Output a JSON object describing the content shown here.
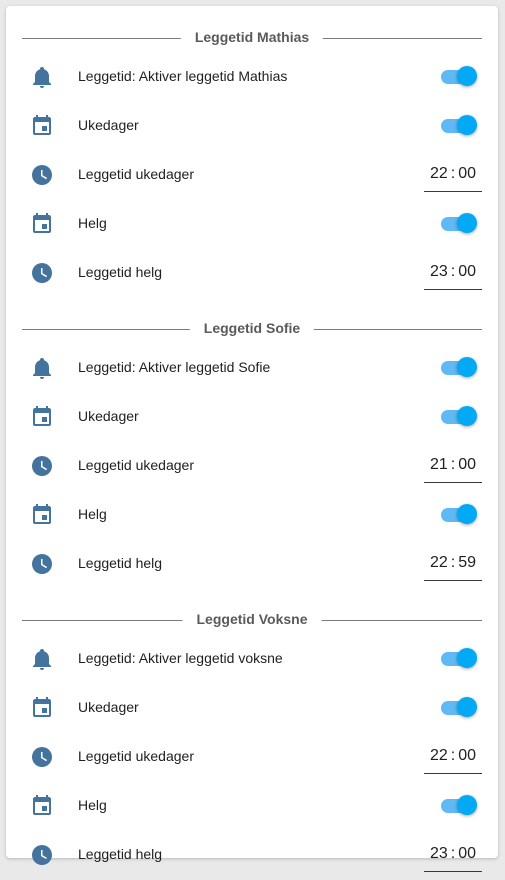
{
  "colors": {
    "icon": "#44739e",
    "toggle_thumb": "#03a9f4",
    "toggle_track": "#5fb9f4",
    "header_text": "#5a5a5a"
  },
  "sections": [
    {
      "title": "Leggetid Mathias",
      "rows": [
        {
          "icon": "bell-icon",
          "label": "Leggetid: Aktiver leggetid Mathias",
          "control": "toggle",
          "on": true
        },
        {
          "icon": "calendar-icon",
          "label": "Ukedager",
          "control": "toggle",
          "on": true
        },
        {
          "icon": "clock-icon",
          "label": "Leggetid ukedager",
          "control": "time",
          "hour": "22",
          "minute": "00"
        },
        {
          "icon": "calendar-icon",
          "label": "Helg",
          "control": "toggle",
          "on": true
        },
        {
          "icon": "clock-icon",
          "label": "Leggetid helg",
          "control": "time",
          "hour": "23",
          "minute": "00"
        }
      ]
    },
    {
      "title": "Leggetid Sofie",
      "rows": [
        {
          "icon": "bell-icon",
          "label": "Leggetid: Aktiver leggetid Sofie",
          "control": "toggle",
          "on": true
        },
        {
          "icon": "calendar-icon",
          "label": "Ukedager",
          "control": "toggle",
          "on": true
        },
        {
          "icon": "clock-icon",
          "label": "Leggetid ukedager",
          "control": "time",
          "hour": "21",
          "minute": "00"
        },
        {
          "icon": "calendar-icon",
          "label": "Helg",
          "control": "toggle",
          "on": true
        },
        {
          "icon": "clock-icon",
          "label": "Leggetid helg",
          "control": "time",
          "hour": "22",
          "minute": "59"
        }
      ]
    },
    {
      "title": "Leggetid Voksne",
      "rows": [
        {
          "icon": "bell-icon",
          "label": "Leggetid: Aktiver leggetid voksne",
          "control": "toggle",
          "on": true
        },
        {
          "icon": "calendar-icon",
          "label": "Ukedager",
          "control": "toggle",
          "on": true
        },
        {
          "icon": "clock-icon",
          "label": "Leggetid ukedager",
          "control": "time",
          "hour": "22",
          "minute": "00"
        },
        {
          "icon": "calendar-icon",
          "label": "Helg",
          "control": "toggle",
          "on": true
        },
        {
          "icon": "clock-icon",
          "label": "Leggetid helg",
          "control": "time",
          "hour": "23",
          "minute": "00"
        }
      ]
    }
  ]
}
